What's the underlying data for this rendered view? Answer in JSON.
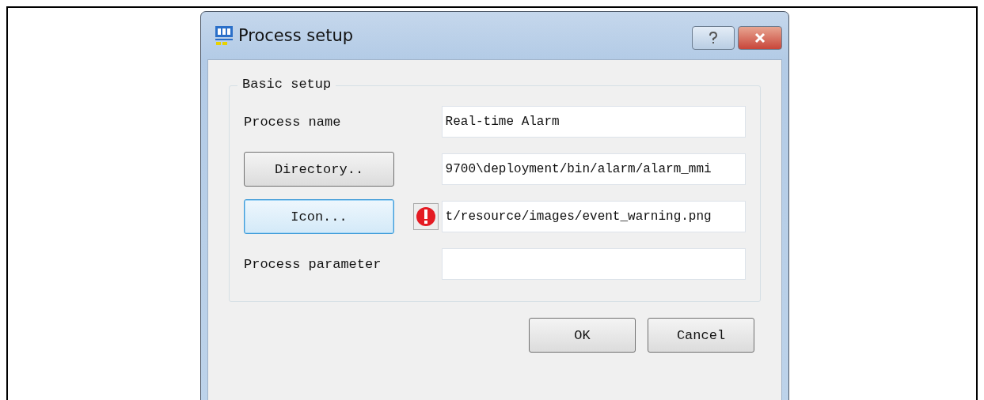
{
  "window": {
    "title": "Process setup"
  },
  "group": {
    "title": "Basic setup",
    "rows": [
      {
        "kind": "label",
        "label": "Process name",
        "value": "Real-time Alarm"
      },
      {
        "kind": "button",
        "label": "Directory..",
        "focused": false,
        "value": "9700\\deployment/bin/alarm/alarm_mmi"
      },
      {
        "kind": "button",
        "label": "Icon...",
        "focused": true,
        "warning": true,
        "value": "t/resource/images/event_warning.png"
      },
      {
        "kind": "label",
        "label": "Process parameter"
      }
    ]
  },
  "buttons": [
    "OK",
    "Cancel"
  ]
}
